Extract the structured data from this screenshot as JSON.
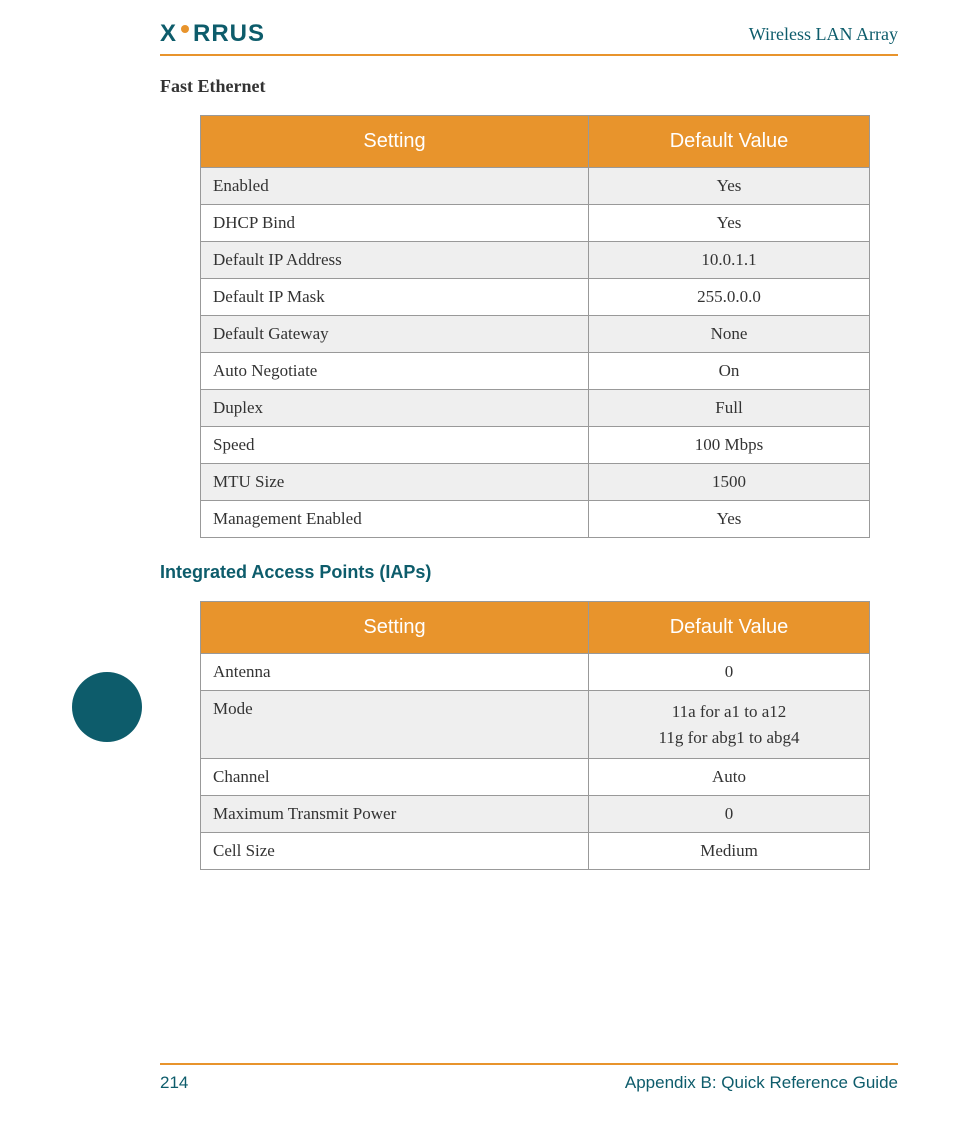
{
  "header": {
    "brand": "XIRRUS",
    "title": "Wireless LAN Array"
  },
  "section1": {
    "title": "Fast Ethernet",
    "headers": {
      "col1": "Setting",
      "col2": "Default Value"
    },
    "rows": [
      {
        "setting": "Enabled",
        "value": "Yes",
        "shaded": true
      },
      {
        "setting": "DHCP Bind",
        "value": "Yes",
        "shaded": false
      },
      {
        "setting": "Default IP Address",
        "value": "10.0.1.1",
        "shaded": true
      },
      {
        "setting": "Default IP Mask",
        "value": "255.0.0.0",
        "shaded": false
      },
      {
        "setting": "Default Gateway",
        "value": "None",
        "shaded": true
      },
      {
        "setting": "Auto Negotiate",
        "value": "On",
        "shaded": false
      },
      {
        "setting": "Duplex",
        "value": "Full",
        "shaded": true
      },
      {
        "setting": "Speed",
        "value": "100 Mbps",
        "shaded": false
      },
      {
        "setting": "MTU Size",
        "value": "1500",
        "shaded": true
      },
      {
        "setting": "Management Enabled",
        "value": "Yes",
        "shaded": false
      }
    ]
  },
  "section2": {
    "title": "Integrated Access Points (IAPs)",
    "headers": {
      "col1": "Setting",
      "col2": "Default Value"
    },
    "rows": [
      {
        "setting": "Antenna",
        "value": "0",
        "shaded": false
      },
      {
        "setting": "Mode",
        "value_line1": "11a for a1 to a12",
        "value_line2": "11g for abg1 to abg4",
        "shaded": true,
        "multiline": true
      },
      {
        "setting": "Channel",
        "value": "Auto",
        "shaded": false
      },
      {
        "setting": "Maximum Transmit Power",
        "value": "0",
        "shaded": true
      },
      {
        "setting": "Cell Size",
        "value": "Medium",
        "shaded": false
      }
    ]
  },
  "footer": {
    "page": "214",
    "appendix": "Appendix B: Quick Reference Guide"
  }
}
